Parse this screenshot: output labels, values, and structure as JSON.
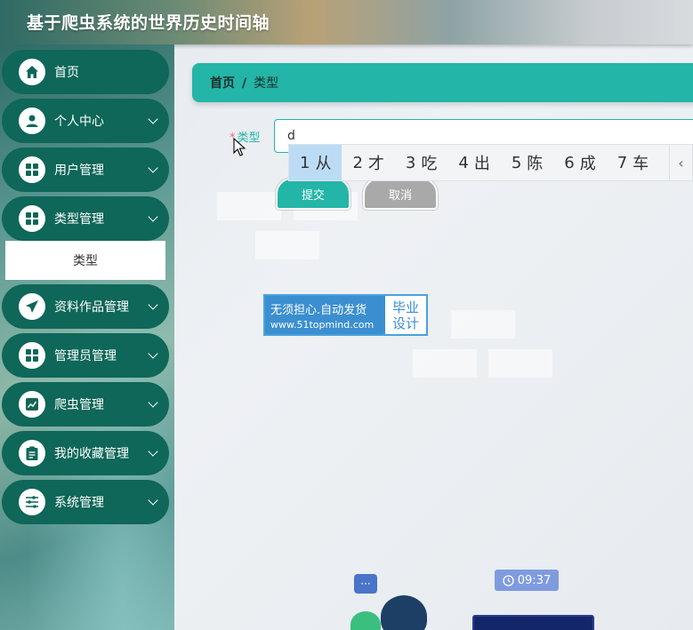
{
  "header": {
    "title": "基于爬虫系统的世界历史时间轴"
  },
  "sidebar": {
    "items": [
      {
        "label": "首页",
        "icon": "home-icon",
        "has_children": false
      },
      {
        "label": "个人中心",
        "icon": "user-icon",
        "has_children": true
      },
      {
        "label": "用户管理",
        "icon": "grid-icon",
        "has_children": true
      },
      {
        "label": "类型管理",
        "icon": "grid-icon",
        "has_children": true
      },
      {
        "label": "资料作品管理",
        "icon": "send-icon",
        "has_children": true
      },
      {
        "label": "管理员管理",
        "icon": "grid-icon",
        "has_children": true
      },
      {
        "label": "爬虫管理",
        "icon": "chart-icon",
        "has_children": true
      },
      {
        "label": "我的收藏管理",
        "icon": "clipboard-icon",
        "has_children": true
      },
      {
        "label": "系统管理",
        "icon": "sliders-icon",
        "has_children": true
      }
    ],
    "submenu": {
      "label": "类型"
    }
  },
  "breadcrumb": {
    "home": "首页",
    "sep": "/",
    "current": "类型"
  },
  "form": {
    "label": "类型",
    "required_mark": "*",
    "value": "d",
    "submit": "提交",
    "cancel": "取消"
  },
  "ime": {
    "candidates": [
      {
        "n": "1",
        "c": "从"
      },
      {
        "n": "2",
        "c": "才"
      },
      {
        "n": "3",
        "c": "吃"
      },
      {
        "n": "4",
        "c": "出"
      },
      {
        "n": "5",
        "c": "陈"
      },
      {
        "n": "6",
        "c": "成"
      },
      {
        "n": "7",
        "c": "车"
      }
    ],
    "prev": "‹"
  },
  "ad": {
    "line1": "无须担心.自动发货",
    "line2": "www.51topmind.com",
    "right1": "毕业",
    "right2": "设计"
  },
  "illustration": {
    "time": "09:37",
    "chat": "···"
  },
  "colors": {
    "accent": "#23b5a7",
    "menu": "#0e6758"
  }
}
